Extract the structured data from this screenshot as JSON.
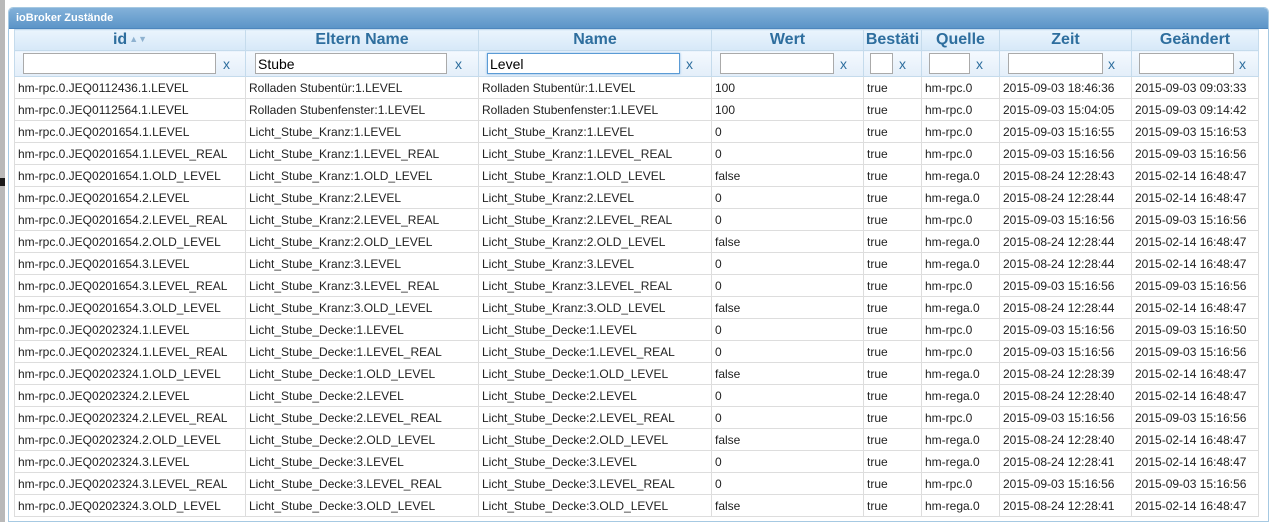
{
  "window": {
    "title": "ioBroker Zustände"
  },
  "columns": [
    {
      "key": "id",
      "label": "id",
      "sortable_icon": "sort-icon"
    },
    {
      "key": "parent",
      "label": "Eltern Name"
    },
    {
      "key": "name",
      "label": "Name"
    },
    {
      "key": "value",
      "label": "Wert"
    },
    {
      "key": "ack",
      "label": "Bestäti"
    },
    {
      "key": "from",
      "label": "Quelle"
    },
    {
      "key": "ts",
      "label": "Zeit"
    },
    {
      "key": "lc",
      "label": "Geändert"
    }
  ],
  "filters": {
    "clear_label": "x",
    "values": [
      "",
      "Stube",
      "Level",
      "",
      "",
      "",
      "",
      ""
    ]
  },
  "rows": [
    [
      "hm-rpc.0.JEQ0112436.1.LEVEL",
      "Rolladen Stubentür:1.LEVEL",
      "Rolladen Stubentür:1.LEVEL",
      "100",
      "true",
      "hm-rpc.0",
      "2015-09-03 18:46:36",
      "2015-09-03 09:03:33"
    ],
    [
      "hm-rpc.0.JEQ0112564.1.LEVEL",
      "Rolladen Stubenfenster:1.LEVEL",
      "Rolladen Stubenfenster:1.LEVEL",
      "100",
      "true",
      "hm-rpc.0",
      "2015-09-03 15:04:05",
      "2015-09-03 09:14:42"
    ],
    [
      "hm-rpc.0.JEQ0201654.1.LEVEL",
      "Licht_Stube_Kranz:1.LEVEL",
      "Licht_Stube_Kranz:1.LEVEL",
      "0",
      "true",
      "hm-rpc.0",
      "2015-09-03 15:16:55",
      "2015-09-03 15:16:53"
    ],
    [
      "hm-rpc.0.JEQ0201654.1.LEVEL_REAL",
      "Licht_Stube_Kranz:1.LEVEL_REAL",
      "Licht_Stube_Kranz:1.LEVEL_REAL",
      "0",
      "true",
      "hm-rpc.0",
      "2015-09-03 15:16:56",
      "2015-09-03 15:16:56"
    ],
    [
      "hm-rpc.0.JEQ0201654.1.OLD_LEVEL",
      "Licht_Stube_Kranz:1.OLD_LEVEL",
      "Licht_Stube_Kranz:1.OLD_LEVEL",
      "false",
      "true",
      "hm-rega.0",
      "2015-08-24 12:28:43",
      "2015-02-14 16:48:47"
    ],
    [
      "hm-rpc.0.JEQ0201654.2.LEVEL",
      "Licht_Stube_Kranz:2.LEVEL",
      "Licht_Stube_Kranz:2.LEVEL",
      "0",
      "true",
      "hm-rega.0",
      "2015-08-24 12:28:44",
      "2015-02-14 16:48:47"
    ],
    [
      "hm-rpc.0.JEQ0201654.2.LEVEL_REAL",
      "Licht_Stube_Kranz:2.LEVEL_REAL",
      "Licht_Stube_Kranz:2.LEVEL_REAL",
      "0",
      "true",
      "hm-rpc.0",
      "2015-09-03 15:16:56",
      "2015-09-03 15:16:56"
    ],
    [
      "hm-rpc.0.JEQ0201654.2.OLD_LEVEL",
      "Licht_Stube_Kranz:2.OLD_LEVEL",
      "Licht_Stube_Kranz:2.OLD_LEVEL",
      "false",
      "true",
      "hm-rega.0",
      "2015-08-24 12:28:44",
      "2015-02-14 16:48:47"
    ],
    [
      "hm-rpc.0.JEQ0201654.3.LEVEL",
      "Licht_Stube_Kranz:3.LEVEL",
      "Licht_Stube_Kranz:3.LEVEL",
      "0",
      "true",
      "hm-rega.0",
      "2015-08-24 12:28:44",
      "2015-02-14 16:48:47"
    ],
    [
      "hm-rpc.0.JEQ0201654.3.LEVEL_REAL",
      "Licht_Stube_Kranz:3.LEVEL_REAL",
      "Licht_Stube_Kranz:3.LEVEL_REAL",
      "0",
      "true",
      "hm-rpc.0",
      "2015-09-03 15:16:56",
      "2015-09-03 15:16:56"
    ],
    [
      "hm-rpc.0.JEQ0201654.3.OLD_LEVEL",
      "Licht_Stube_Kranz:3.OLD_LEVEL",
      "Licht_Stube_Kranz:3.OLD_LEVEL",
      "false",
      "true",
      "hm-rega.0",
      "2015-08-24 12:28:44",
      "2015-02-14 16:48:47"
    ],
    [
      "hm-rpc.0.JEQ0202324.1.LEVEL",
      "Licht_Stube_Decke:1.LEVEL",
      "Licht_Stube_Decke:1.LEVEL",
      "0",
      "true",
      "hm-rpc.0",
      "2015-09-03 15:16:56",
      "2015-09-03 15:16:50"
    ],
    [
      "hm-rpc.0.JEQ0202324.1.LEVEL_REAL",
      "Licht_Stube_Decke:1.LEVEL_REAL",
      "Licht_Stube_Decke:1.LEVEL_REAL",
      "0",
      "true",
      "hm-rpc.0",
      "2015-09-03 15:16:56",
      "2015-09-03 15:16:56"
    ],
    [
      "hm-rpc.0.JEQ0202324.1.OLD_LEVEL",
      "Licht_Stube_Decke:1.OLD_LEVEL",
      "Licht_Stube_Decke:1.OLD_LEVEL",
      "false",
      "true",
      "hm-rega.0",
      "2015-08-24 12:28:39",
      "2015-02-14 16:48:47"
    ],
    [
      "hm-rpc.0.JEQ0202324.2.LEVEL",
      "Licht_Stube_Decke:2.LEVEL",
      "Licht_Stube_Decke:2.LEVEL",
      "0",
      "true",
      "hm-rega.0",
      "2015-08-24 12:28:40",
      "2015-02-14 16:48:47"
    ],
    [
      "hm-rpc.0.JEQ0202324.2.LEVEL_REAL",
      "Licht_Stube_Decke:2.LEVEL_REAL",
      "Licht_Stube_Decke:2.LEVEL_REAL",
      "0",
      "true",
      "hm-rpc.0",
      "2015-09-03 15:16:56",
      "2015-09-03 15:16:56"
    ],
    [
      "hm-rpc.0.JEQ0202324.2.OLD_LEVEL",
      "Licht_Stube_Decke:2.OLD_LEVEL",
      "Licht_Stube_Decke:2.OLD_LEVEL",
      "false",
      "true",
      "hm-rega.0",
      "2015-08-24 12:28:40",
      "2015-02-14 16:48:47"
    ],
    [
      "hm-rpc.0.JEQ0202324.3.LEVEL",
      "Licht_Stube_Decke:3.LEVEL",
      "Licht_Stube_Decke:3.LEVEL",
      "0",
      "true",
      "hm-rega.0",
      "2015-08-24 12:28:41",
      "2015-02-14 16:48:47"
    ],
    [
      "hm-rpc.0.JEQ0202324.3.LEVEL_REAL",
      "Licht_Stube_Decke:3.LEVEL_REAL",
      "Licht_Stube_Decke:3.LEVEL_REAL",
      "0",
      "true",
      "hm-rpc.0",
      "2015-09-03 15:16:56",
      "2015-09-03 15:16:56"
    ],
    [
      "hm-rpc.0.JEQ0202324.3.OLD_LEVEL",
      "Licht_Stube_Decke:3.OLD_LEVEL",
      "Licht_Stube_Decke:3.OLD_LEVEL",
      "false",
      "true",
      "hm-rega.0",
      "2015-08-24 12:28:41",
      "2015-02-14 16:48:47"
    ]
  ]
}
